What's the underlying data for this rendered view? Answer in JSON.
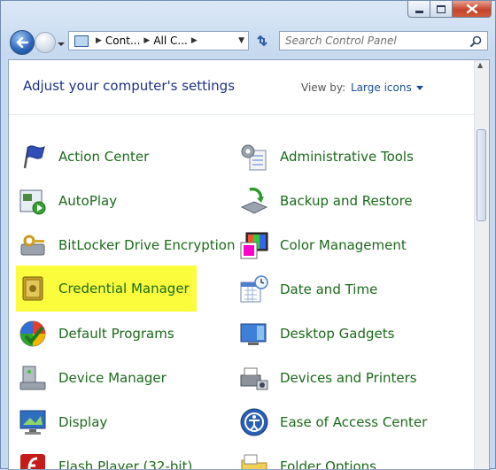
{
  "search": {
    "placeholder": "Search Control Panel"
  },
  "address": {
    "segments": [
      "Cont...",
      "All C..."
    ]
  },
  "header": {
    "title": "Adjust your computer's settings",
    "view_by_label": "View by:",
    "view_by_value": "Large icons"
  },
  "colors": {
    "link_green": "#1a6a1a",
    "title_blue": "#1e3287",
    "highlight_yellow": "#fbfd3c"
  },
  "items": [
    {
      "label": "Action Center",
      "icon": "flag-icon"
    },
    {
      "label": "Administrative Tools",
      "icon": "admin-tools-icon"
    },
    {
      "label": "AutoPlay",
      "icon": "autoplay-icon"
    },
    {
      "label": "Backup and Restore",
      "icon": "backup-icon"
    },
    {
      "label": "BitLocker Drive Encryption",
      "icon": "bitlocker-icon"
    },
    {
      "label": "Color Management",
      "icon": "color-management-icon"
    },
    {
      "label": "Credential Manager",
      "icon": "credential-vault-icon",
      "highlighted": true
    },
    {
      "label": "Date and Time",
      "icon": "calendar-clock-icon"
    },
    {
      "label": "Default Programs",
      "icon": "default-programs-icon"
    },
    {
      "label": "Desktop Gadgets",
      "icon": "gadgets-icon"
    },
    {
      "label": "Device Manager",
      "icon": "device-manager-icon"
    },
    {
      "label": "Devices and Printers",
      "icon": "printer-icon"
    },
    {
      "label": "Display",
      "icon": "display-icon"
    },
    {
      "label": "Ease of Access Center",
      "icon": "ease-of-access-icon"
    },
    {
      "label": "Flash Player (32-bit)",
      "icon": "flash-icon"
    },
    {
      "label": "Folder Options",
      "icon": "folder-options-icon"
    }
  ]
}
